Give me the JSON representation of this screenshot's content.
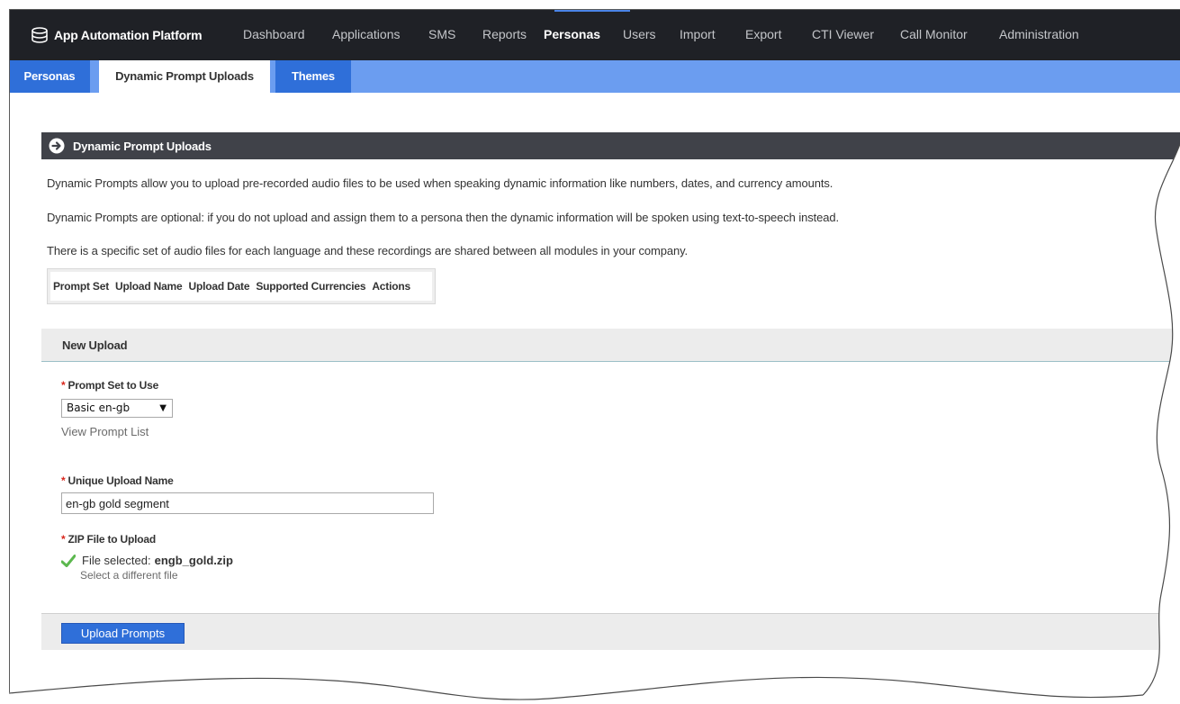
{
  "app": {
    "brand_icon": "database-icon",
    "brand_name": "App Automation Platform"
  },
  "nav": {
    "items": [
      {
        "label": "Dashboard"
      },
      {
        "label": "Applications"
      },
      {
        "label": "SMS"
      },
      {
        "label": "Reports"
      },
      {
        "label": "Personas"
      },
      {
        "label": "Users"
      },
      {
        "label": "Import"
      },
      {
        "label": "Export"
      },
      {
        "label": "CTI Viewer"
      },
      {
        "label": "Call Monitor"
      },
      {
        "label": "Administration"
      }
    ],
    "active": "Personas"
  },
  "subtabs": {
    "items": [
      {
        "label": "Personas"
      },
      {
        "label": "Dynamic Prompt Uploads"
      },
      {
        "label": "Themes"
      }
    ],
    "active": "Dynamic Prompt Uploads"
  },
  "section": {
    "icon": "arrow-circle-right-icon",
    "title": "Dynamic Prompt Uploads",
    "paragraphs": [
      "Dynamic Prompts allow you to upload pre-recorded audio files to be used when speaking dynamic information like numbers, dates, and currency amounts.",
      "Dynamic Prompts are optional: if you do not upload and assign them to a persona then the dynamic information will be spoken using text-to-speech instead.",
      "There is a specific set of audio files for each language and these recordings are shared between all modules in your company."
    ]
  },
  "table": {
    "columns": [
      "Prompt Set",
      "Upload Name",
      "Upload Date",
      "Supported Currencies",
      "Actions"
    ]
  },
  "new_upload": {
    "title": "New Upload",
    "required_marker": "*",
    "prompt_set_label": "Prompt Set to Use",
    "prompt_set_value": "Basic en-gb",
    "view_prompt_list": "View Prompt List",
    "upload_name_label": "Unique Upload Name",
    "upload_name_value": "en-gb gold segment",
    "zip_label": "ZIP File to Upload",
    "file_selected_prefix": "File selected:",
    "file_name": "engb_gold.zip",
    "select_different": "Select a different file",
    "submit_label": "Upload Prompts"
  },
  "colors": {
    "nav_bg": "#1f2126",
    "subnav_bg": "#6b9df0",
    "accent": "#2f6fd9",
    "section_header_bg": "#404249",
    "required": "#d9261c",
    "check": "#5cb84f"
  }
}
